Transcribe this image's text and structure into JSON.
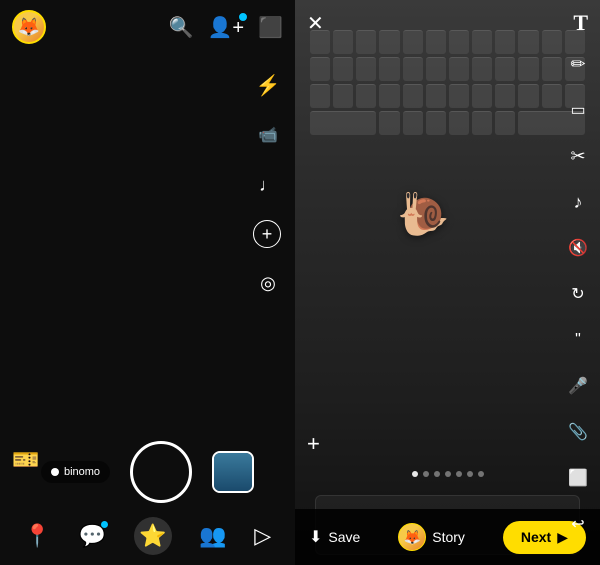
{
  "left": {
    "avatar_emoji": "🦊",
    "toolbar": {
      "flash_icon": "⚡",
      "video_icon": "📹",
      "music_icon": "♪",
      "plus_icon": "+",
      "focus_icon": "◎"
    },
    "capture_btn_label": "Capture",
    "filter_label": "binomo",
    "bottom_nav": {
      "location_icon": "📍",
      "chat_icon": "💬",
      "camera_icon": "⭐",
      "friends_icon": "👥",
      "send_icon": "▷"
    },
    "sticker_icon": "🎫"
  },
  "right": {
    "close_icon": "✕",
    "text_tool": "T",
    "tools": [
      "✏",
      "□",
      "✂",
      "♪",
      "🔇",
      "↺",
      "❝",
      "🎤",
      "📎",
      "⬜",
      "↩"
    ],
    "snail_emoji": "🐌",
    "pagination_dots": [
      1,
      2,
      3,
      4,
      5,
      6,
      7
    ],
    "active_dot": 0,
    "plus_icon": "+",
    "bottom_bar": {
      "save_icon": "⬇",
      "save_label": "Save",
      "story_label": "Story",
      "next_label": "Next",
      "next_arrow": "▶"
    }
  }
}
